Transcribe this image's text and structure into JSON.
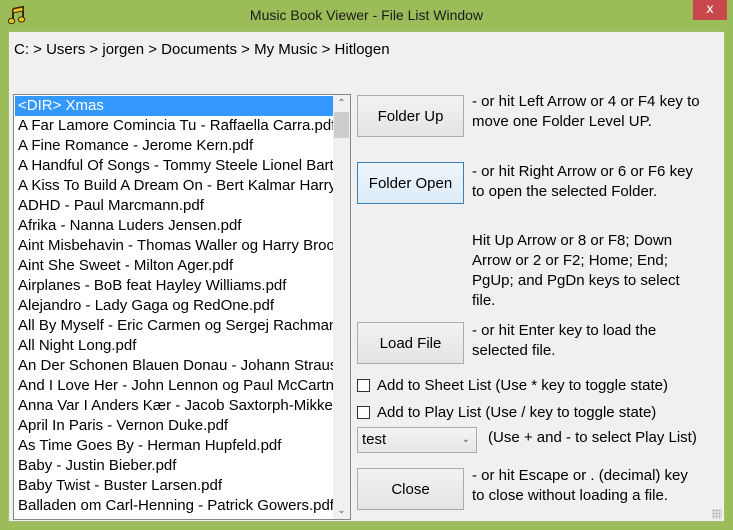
{
  "window": {
    "title": "Music Book Viewer - File List Window",
    "app_icon": "music-note-icon",
    "close_label": "x",
    "frame_color": "#9cbc5a",
    "close_color": "#c7474b"
  },
  "breadcrumb": "C: > Users > jorgen > Documents > My Music > Hitlogen",
  "file_list": {
    "selected_index": 0,
    "selection_color": "#3399ff",
    "items": [
      "<DIR> Xmas",
      "A Far Lamore Comincia Tu - Raffaella Carra.pdf",
      "A Fine Romance - Jerome Kern.pdf",
      "A Handful Of Songs - Tommy Steele Lionel Bart.pdf",
      "A Kiss To Build A Dream On -  Bert Kalmar Harry Ruby.pdf",
      "ADHD - Paul Marcmann.pdf",
      "Afrika - Nanna Luders Jensen.pdf",
      "Aint Misbehavin - Thomas Waller og Harry Brooks.pdf",
      "Aint She Sweet - Milton Ager.pdf",
      "Airplanes - BoB feat Hayley Williams.pdf",
      "Alejandro - Lady Gaga og RedOne.pdf",
      "All By Myself - Eric Carmen og Sergej Rachmaninov.pdf",
      "All Night Long.pdf",
      "An Der Schonen Blauen Donau - Johann Strauss.pdf",
      "And I Love Her - John Lennon og Paul McCartney.pdf",
      "Anna Var I Anders Kær - Jacob Saxtorph-Mikkelsen.pdf",
      "April In Paris - Vernon Duke.pdf",
      "As Time Goes By - Herman Hupfeld.pdf",
      "Baby - Justin Bieber.pdf",
      "Baby Twist - Buster Larsen.pdf",
      "Balladen om Carl-Henning - Patrick Gowers.pdf"
    ]
  },
  "buttons": {
    "folder_up": "Folder Up",
    "folder_open": "Folder Open",
    "load_file": "Load File",
    "close": "Close"
  },
  "help": {
    "folder_up": [
      "- or hit Left Arrow or 4 or F4 key to",
      "move one Folder Level UP."
    ],
    "folder_open": [
      "- or hit Right Arrow or 6 or F6 key",
      "to open the selected Folder."
    ],
    "navigation": [
      "Hit Up Arrow or 8 or F8; Down",
      "Arrow or 2 or F2; Home; End;",
      "PgUp; and PgDn keys to select",
      "file."
    ],
    "load_file": [
      "- or hit Enter key to load the",
      "selected file."
    ],
    "close": [
      "- or hit Escape or . (decimal) key",
      "to close without loading a file."
    ],
    "play_list_select": "(Use + and - to select Play List)"
  },
  "checkboxes": {
    "sheet_list": {
      "label": "Add to Sheet List (Use * key to toggle state)",
      "checked": false
    },
    "play_list": {
      "label": "Add to Play List (Use / key to toggle state)",
      "checked": false
    }
  },
  "play_list_combo": {
    "selected": "test"
  }
}
